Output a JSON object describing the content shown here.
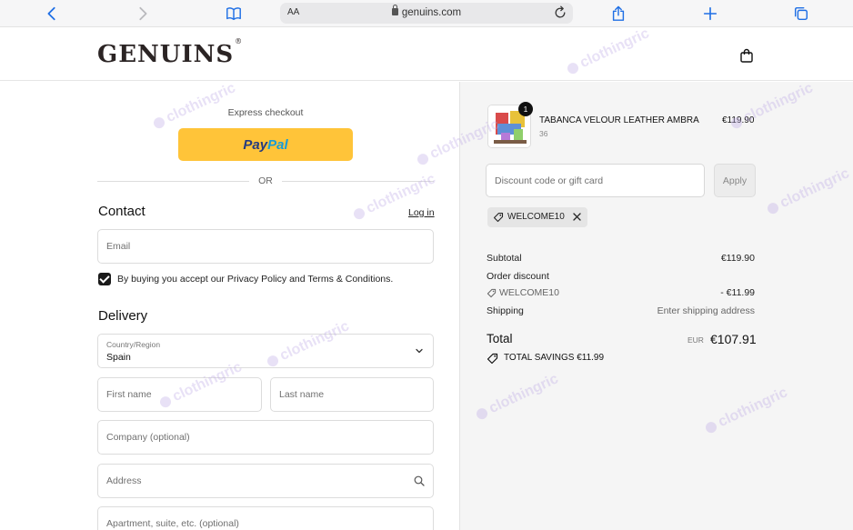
{
  "browser": {
    "reader_label": "AA",
    "url": "genuins.com"
  },
  "header": {
    "logo": "GENUINS",
    "logo_mark": "®"
  },
  "checkout": {
    "express_label": "Express checkout",
    "paypal_part1": "Pay",
    "paypal_part2": "Pal",
    "or_label": "OR",
    "contact_title": "Contact",
    "login_label": "Log in",
    "email_placeholder": "Email",
    "consent_text": "By buying you accept our Privacy Policy and Terms & Conditions.",
    "consent_checked": true,
    "delivery_title": "Delivery",
    "country_label": "Country/Region",
    "country_value": "Spain",
    "first_name_placeholder": "First name",
    "last_name_placeholder": "Last name",
    "company_placeholder": "Company (optional)",
    "address_placeholder": "Address",
    "apartment_placeholder": "Apartment, suite, etc. (optional)"
  },
  "summary": {
    "item": {
      "quantity": "1",
      "name": "TABANCA VELOUR LEATHER AMBRA",
      "size": "36",
      "price": "€119.90"
    },
    "discount_placeholder": "Discount code or gift card",
    "apply_label": "Apply",
    "applied_code": "WELCOME10",
    "subtotal_label": "Subtotal",
    "subtotal_value": "€119.90",
    "order_discount_label": "Order discount",
    "discount_code": "WELCOME10",
    "discount_value": "- €11.99",
    "shipping_label": "Shipping",
    "shipping_value": "Enter shipping address",
    "total_label": "Total",
    "total_currency": "EUR",
    "total_value": "€107.91",
    "savings_text": "TOTAL SAVINGS  €11.99"
  },
  "watermark": "clothingric",
  "colors": {
    "paypal_yellow": "#ffc439",
    "paypal_dark": "#253b80",
    "paypal_light": "#179bd7",
    "browser_blue": "#1f6fe5",
    "summary_bg": "#f5f5f5"
  }
}
